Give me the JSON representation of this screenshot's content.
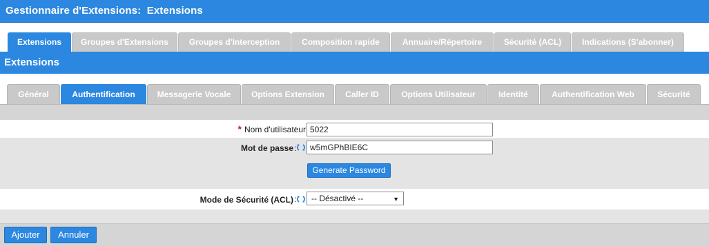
{
  "header": {
    "title": "Gestionnaire d'Extensions:  Extensions"
  },
  "main_tabs": [
    {
      "label": "Extensions",
      "active": true
    },
    {
      "label": "Groupes d'Extensions",
      "active": false
    },
    {
      "label": "Groupes d'Interception",
      "active": false
    },
    {
      "label": "Composition rapide",
      "active": false
    },
    {
      "label": "Annuaire/Répertoire",
      "active": false
    },
    {
      "label": "Sécurité (ACL)",
      "active": false
    },
    {
      "label": "Indications (S'abonner)",
      "active": false
    }
  ],
  "section": {
    "title": "Extensions"
  },
  "sub_tabs": [
    {
      "label": "Général",
      "active": false
    },
    {
      "label": "Authentification",
      "active": true
    },
    {
      "label": "Messagerie Vocale",
      "active": false
    },
    {
      "label": "Options Extension",
      "active": false
    },
    {
      "label": "Caller ID",
      "active": false
    },
    {
      "label": "Options Utilisateur",
      "active": false
    },
    {
      "label": "Identité",
      "active": false
    },
    {
      "label": "Authentification Web",
      "active": false
    },
    {
      "label": "Sécurité",
      "active": false
    }
  ],
  "form": {
    "username": {
      "required_marker": "*",
      "label": "Nom d'utilisateur",
      "colon": ":",
      "value": "5022"
    },
    "password": {
      "label": "Mot de passe",
      "colon": ":",
      "value": "w5mGPhBIE6C",
      "icon": "refresh-icon"
    },
    "generate_button": "Generate Password",
    "security_mode": {
      "label": "Mode de Sécurité (ACL)",
      "colon": ":",
      "selected": "-- Désactivé --",
      "icon": "refresh-icon"
    }
  },
  "footer": {
    "add_label": "Ajouter",
    "cancel_label": "Annuler"
  },
  "colors": {
    "accent": "#2b87e0",
    "tab_inactive": "#c9c9c9",
    "required": "#c0262c"
  }
}
